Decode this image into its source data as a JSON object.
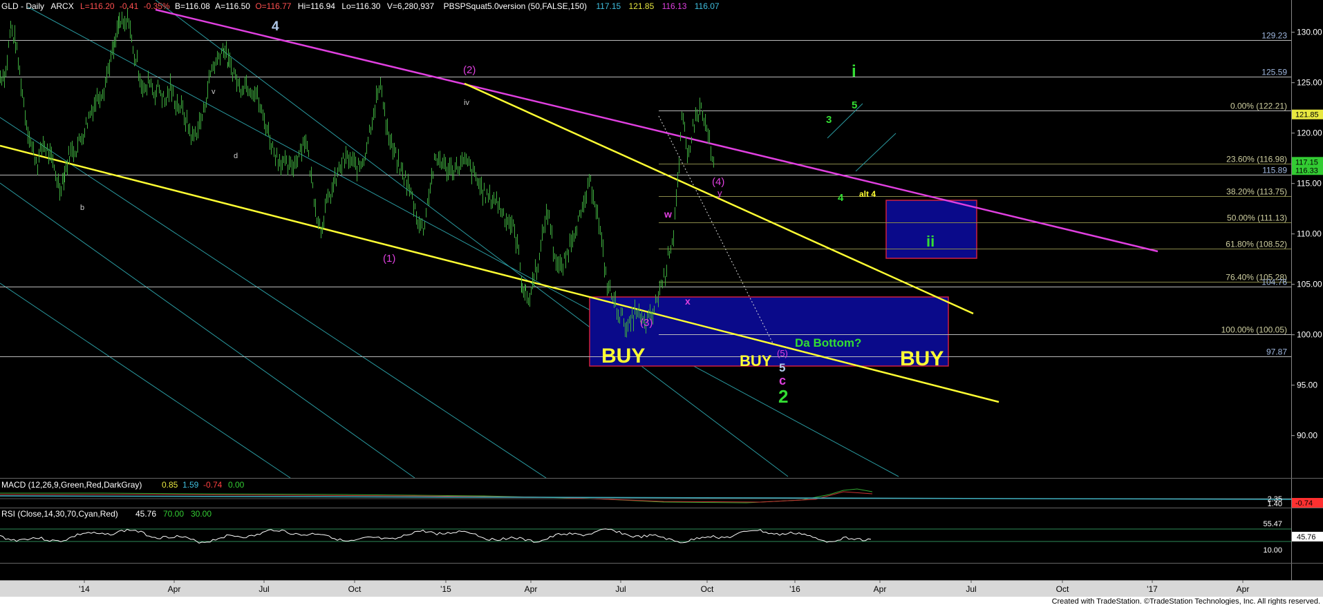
{
  "header": {
    "symbol": "GLD - Daily",
    "exchange": "ARCX",
    "last": "L=116.20",
    "change": "-0.41",
    "change_pct": "-0.35%",
    "bid": "B=116.08",
    "ask": "A=116.50",
    "open": "O=116.77",
    "high": "Hi=116.94",
    "low": "Lo=116.30",
    "volume": "V=6,280,937",
    "indicator": "PBSPSquat5.0version (50,FALSE,150)",
    "ind_values": [
      "117.15",
      "121.85",
      "116.13",
      "116.07"
    ]
  },
  "colors": {
    "background": "#000000",
    "price_bars": "#3fae3f",
    "magenta": "#e040e0",
    "yellow": "#ffff33",
    "cyan_channel": "#2a9aa0",
    "buy_box_fill": "#0a0a8a",
    "buy_box_border": "#d02040",
    "wave_green": "#33dd33"
  },
  "chart_data": {
    "type": "line",
    "title": "GLD - Daily",
    "y_axis_ticks": [
      "130.00",
      "125.00",
      "120.00",
      "115.00",
      "110.00",
      "105.00",
      "100.00",
      "95.00",
      "90.00"
    ],
    "y_tick_values": [
      130,
      125,
      120,
      115,
      110,
      105,
      100,
      95,
      90
    ],
    "ylim": [
      85.8,
      133.2
    ],
    "x_axis_ticks": [
      "'14",
      "Apr",
      "Jul",
      "Oct",
      "'15",
      "Apr",
      "Jul",
      "Oct",
      "'16",
      "Apr",
      "Jul",
      "Oct",
      "'17",
      "Apr"
    ],
    "grid": false,
    "series": [
      {
        "points": [
          [
            0,
            125.6
          ],
          [
            8,
            126
          ],
          [
            15,
            130.5
          ],
          [
            22,
            129
          ],
          [
            30,
            125
          ],
          [
            38,
            121
          ],
          [
            46,
            118.5
          ],
          [
            54,
            117
          ],
          [
            62,
            119
          ],
          [
            70,
            118
          ],
          [
            78,
            116.5
          ],
          [
            86,
            114.5
          ],
          [
            93,
            116
          ],
          [
            100,
            118
          ],
          [
            110,
            118.5
          ],
          [
            120,
            120
          ],
          [
            130,
            122
          ],
          [
            140,
            123.5
          ],
          [
            150,
            124.5
          ],
          [
            158,
            127
          ],
          [
            165,
            128.5
          ],
          [
            172,
            131
          ],
          [
            180,
            130.5
          ],
          [
            186,
            131.5
          ],
          [
            192,
            128
          ],
          [
            198,
            127
          ],
          [
            204,
            125
          ],
          [
            210,
            124
          ],
          [
            216,
            125.5
          ],
          [
            222,
            124
          ],
          [
            230,
            124.5
          ],
          [
            238,
            123
          ],
          [
            246,
            124.5
          ],
          [
            254,
            123
          ],
          [
            262,
            122.5
          ],
          [
            270,
            121
          ],
          [
            278,
            119.5
          ],
          [
            286,
            120.5
          ],
          [
            294,
            122
          ],
          [
            300,
            124.5
          ],
          [
            306,
            126.5
          ],
          [
            312,
            127
          ],
          [
            318,
            128
          ],
          [
            323,
            128.5
          ],
          [
            330,
            127
          ],
          [
            338,
            126
          ],
          [
            346,
            124.5
          ],
          [
            354,
            125
          ],
          [
            362,
            124.5
          ],
          [
            370,
            124
          ],
          [
            378,
            122
          ],
          [
            386,
            120.5
          ],
          [
            394,
            118.5
          ],
          [
            402,
            117.5
          ],
          [
            410,
            117
          ],
          [
            418,
            116.5
          ],
          [
            426,
            117
          ],
          [
            434,
            118.5
          ],
          [
            442,
            119.5
          ],
          [
            450,
            115.5
          ],
          [
            458,
            112
          ],
          [
            464,
            110.5
          ],
          [
            470,
            112.5
          ],
          [
            478,
            114
          ],
          [
            486,
            115.5
          ],
          [
            494,
            117
          ],
          [
            502,
            117.5
          ],
          [
            510,
            117
          ],
          [
            518,
            116.5
          ],
          [
            526,
            117.5
          ],
          [
            532,
            119.5
          ],
          [
            538,
            121.5
          ],
          [
            546,
            124
          ],
          [
            552,
            124.5
          ],
          [
            558,
            121
          ],
          [
            564,
            119
          ],
          [
            570,
            118
          ],
          [
            578,
            116.5
          ],
          [
            586,
            115.5
          ],
          [
            594,
            114
          ],
          [
            600,
            112.5
          ],
          [
            606,
            111
          ],
          [
            612,
            110.5
          ],
          [
            620,
            114
          ],
          [
            628,
            117
          ],
          [
            636,
            117.5
          ],
          [
            644,
            116.5
          ],
          [
            652,
            116.5
          ],
          [
            660,
            116.5
          ],
          [
            668,
            117
          ],
          [
            676,
            117
          ],
          [
            684,
            116
          ],
          [
            692,
            115
          ],
          [
            700,
            114
          ],
          [
            708,
            113.5
          ],
          [
            716,
            113.5
          ],
          [
            724,
            112.5
          ],
          [
            732,
            111.5
          ],
          [
            740,
            111
          ],
          [
            748,
            109
          ],
          [
            755,
            105
          ],
          [
            760,
            104
          ],
          [
            766,
            103.5
          ],
          [
            772,
            106
          ],
          [
            780,
            107.5
          ],
          [
            788,
            111.5
          ],
          [
            794,
            112
          ],
          [
            800,
            108.5
          ],
          [
            806,
            107
          ],
          [
            812,
            106.5
          ],
          [
            818,
            107.5
          ],
          [
            826,
            109.5
          ],
          [
            834,
            111
          ],
          [
            842,
            112
          ],
          [
            848,
            114
          ],
          [
            854,
            115
          ],
          [
            860,
            113.5
          ],
          [
            866,
            111
          ],
          [
            872,
            108
          ],
          [
            878,
            105
          ],
          [
            884,
            104
          ],
          [
            890,
            103
          ],
          [
            896,
            102
          ],
          [
            902,
            101.5
          ],
          [
            908,
            100.5
          ],
          [
            914,
            101.5
          ],
          [
            920,
            102.5
          ],
          [
            926,
            101.5
          ],
          [
            932,
            101
          ],
          [
            938,
            101.5
          ],
          [
            944,
            102
          ],
          [
            950,
            103.5
          ],
          [
            956,
            105
          ],
          [
            962,
            106
          ],
          [
            968,
            108.5
          ],
          [
            974,
            110
          ],
          [
            978,
            114
          ],
          [
            982,
            116.5
          ],
          [
            986,
            121.5
          ],
          [
            990,
            120
          ],
          [
            994,
            117.5
          ],
          [
            998,
            119
          ],
          [
            1002,
            120.5
          ],
          [
            1006,
            121.5
          ],
          [
            1010,
            122
          ],
          [
            1014,
            122.5
          ],
          [
            1018,
            121
          ],
          [
            1022,
            120.5
          ],
          [
            1026,
            119
          ],
          [
            1030,
            117
          ],
          [
            1034,
            116.5
          ]
        ]
      }
    ],
    "levels": [
      {
        "label": "129.23",
        "value": 129.23
      },
      {
        "label": "125.59",
        "value": 125.59
      },
      {
        "label": "0.00% (122.21)",
        "value": 122.21
      },
      {
        "label": "23.60% (116.98)",
        "value": 116.98
      },
      {
        "label": "115.89",
        "value": 115.89
      },
      {
        "label": "38.20% (113.75)",
        "value": 113.75
      },
      {
        "label": "50.00% (111.13)",
        "value": 111.13
      },
      {
        "label": "61.80% (108.52)",
        "value": 108.52
      },
      {
        "label": "76.40% (105.28)",
        "value": 105.28
      },
      {
        "label": "104.76",
        "value": 104.76
      },
      {
        "label": "100.00% (100.05)",
        "value": 100.05
      },
      {
        "label": "97.87",
        "value": 97.87
      }
    ],
    "price_tags": [
      {
        "label": "121.85",
        "color": "#e8e840",
        "value": 121.85
      },
      {
        "label": "117.15",
        "color": "#33cc33",
        "value": 117.15
      },
      {
        "label": "116.33",
        "color": "#33cc33",
        "value": 116.33
      }
    ],
    "annotations": {
      "wave_labels": [
        "4",
        "(2)",
        "iv",
        "d",
        "b",
        "(1)",
        "(3)",
        "w",
        "x",
        "y",
        "(4)",
        "(5)",
        "5",
        "c",
        "2",
        "i",
        "3",
        "5",
        "4",
        "alt 4",
        "ii",
        "v"
      ],
      "box_text": [
        "BUY",
        "BUY",
        "BUY",
        "Da Bottom?"
      ]
    }
  },
  "macd": {
    "label": "MACD (12,26,9,Green,Red,DarkGray)",
    "values": [
      "0.85",
      "1.59",
      "-0.74",
      "0.00"
    ],
    "value_colors": [
      "#e8e840",
      "#40c0e0",
      "#ff4040",
      "#33cc33"
    ],
    "right_labels": [
      "2.35",
      "1.40"
    ],
    "right_tag": "-0.74",
    "right_tag_color": "#ff3030"
  },
  "rsi": {
    "label": "RSI (Close,14,30,70,Cyan,Red)",
    "values": [
      "45.76",
      "70.00",
      "30.00"
    ],
    "value_colors": [
      "#ffffff",
      "#33cc33",
      "#33cc33"
    ],
    "right_labels": [
      "55.47",
      "10.00"
    ],
    "right_tag": "45.76"
  },
  "footer": {
    "credit": "Created with TradeStation. ©TradeStation Technologies, Inc. All rights reserved."
  }
}
